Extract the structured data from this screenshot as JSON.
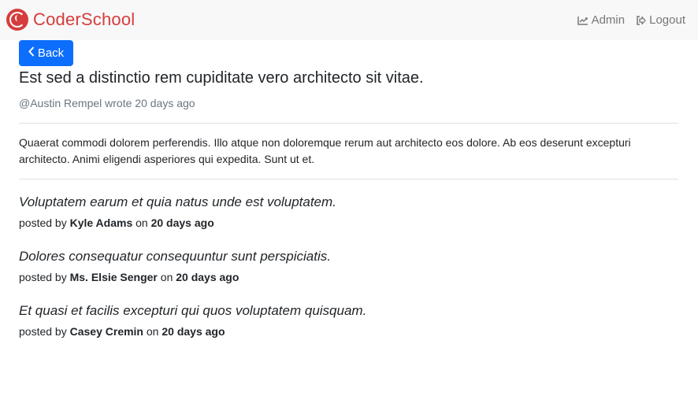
{
  "navbar": {
    "brand": "CoderSchool",
    "admin_label": "Admin",
    "logout_label": "Logout"
  },
  "back_button": {
    "label": "Back"
  },
  "post": {
    "title": "Est sed a distinctio rem cupiditate vero architecto sit vitae.",
    "author": "@Austin Rempel",
    "wrote": "wrote",
    "time": "20 days ago",
    "body": "Quaerat commodi dolorem perferendis. Illo atque non doloremque rerum aut architecto eos dolore. Ab eos deserunt excepturi architecto. Animi eligendi asperiores qui expedita. Sunt ut et."
  },
  "comments": [
    {
      "text": "Voluptatem earum et quia natus unde est voluptatem.",
      "posted_by": "posted by",
      "author": "Kyle Adams",
      "on": "on",
      "time": "20 days ago"
    },
    {
      "text": "Dolores consequatur consequuntur sunt perspiciatis.",
      "posted_by": "posted by",
      "author": "Ms. Elsie Senger",
      "on": "on",
      "time": "20 days ago"
    },
    {
      "text": "Et quasi et facilis excepturi qui quos voluptatem quisquam.",
      "posted_by": "posted by",
      "author": "Casey Cremin",
      "on": "on",
      "time": "20 days ago"
    }
  ],
  "colors": {
    "brand": "#d63c3c",
    "primary": "#0d6efd",
    "navbar_bg": "#f8f8f8",
    "muted": "#6c757d"
  },
  "icons": {
    "brand": "coderschool-logo-icon",
    "admin": "chart-line-icon",
    "logout": "sign-out-icon",
    "back": "chevron-left-icon"
  }
}
